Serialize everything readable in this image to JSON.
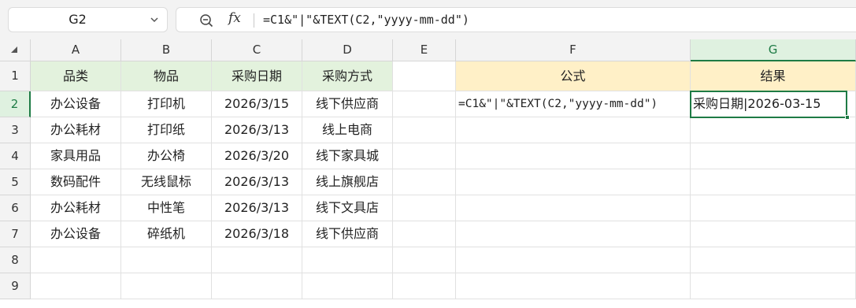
{
  "toolbar": {
    "name_box": "G2",
    "formula": "=C1&\"|\"&TEXT(C2,\"yyyy-mm-dd\")",
    "fx_label": "fx"
  },
  "grid": {
    "columns": [
      "A",
      "B",
      "C",
      "D",
      "E",
      "F",
      "G"
    ],
    "rows": [
      "1",
      "2",
      "3",
      "4",
      "5",
      "6",
      "7",
      "8",
      "9"
    ],
    "active_cell": "G2",
    "header_fill": "#e3f2dd",
    "formula_header_fill": "#fff0c7",
    "accent": "#1e7b45"
  },
  "table": {
    "headers": [
      "品类",
      "物品",
      "采购日期",
      "采购方式"
    ],
    "rows": [
      [
        "办公设备",
        "打印机",
        "2026/3/15",
        "线下供应商"
      ],
      [
        "办公耗材",
        "打印纸",
        "2026/3/13",
        "线上电商"
      ],
      [
        "家具用品",
        "办公椅",
        "2026/3/20",
        "线下家具城"
      ],
      [
        "数码配件",
        "无线鼠标",
        "2026/3/13",
        "线上旗舰店"
      ],
      [
        "办公耗材",
        "中性笔",
        "2026/3/13",
        "线下文具店"
      ],
      [
        "办公设备",
        "碎纸机",
        "2026/3/18",
        "线下供应商"
      ]
    ]
  },
  "example": {
    "formula_header": "公式",
    "result_header": "结果",
    "formula_text": "=C1&\"|\"&TEXT(C2,\"yyyy-mm-dd\")",
    "result_text": "采购日期|2026-03-15"
  }
}
